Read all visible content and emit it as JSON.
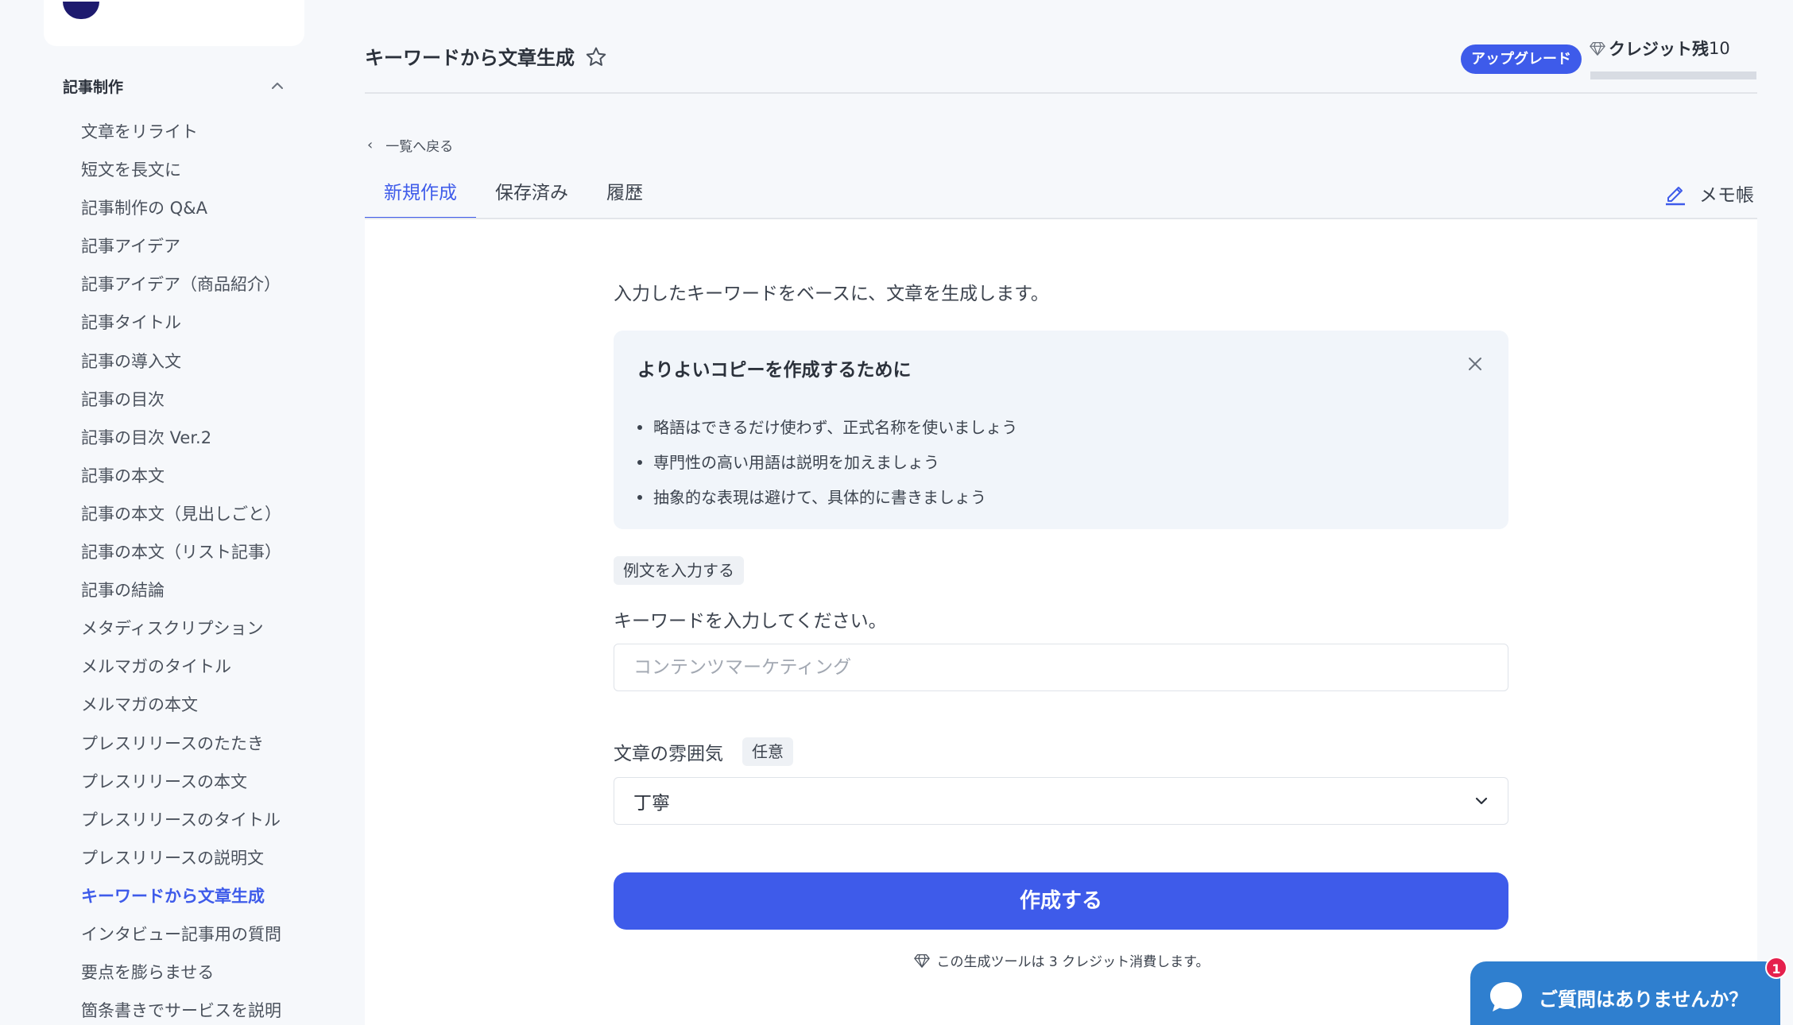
{
  "sidebar": {
    "section_title": "記事制作",
    "items": [
      {
        "label": "文章をリライト"
      },
      {
        "label": "短文を長文に"
      },
      {
        "label": "記事制作の Q&A"
      },
      {
        "label": "記事アイデア"
      },
      {
        "label": "記事アイデア（商品紹介）"
      },
      {
        "label": "記事タイトル"
      },
      {
        "label": "記事の導入文"
      },
      {
        "label": "記事の目次"
      },
      {
        "label": "記事の目次 Ver.2"
      },
      {
        "label": "記事の本文"
      },
      {
        "label": "記事の本文（見出しごと）"
      },
      {
        "label": "記事の本文（リスト記事）"
      },
      {
        "label": "記事の結論"
      },
      {
        "label": "メタディスクリプション"
      },
      {
        "label": "メルマガのタイトル"
      },
      {
        "label": "メルマガの本文"
      },
      {
        "label": "プレスリリースのたたき"
      },
      {
        "label": "プレスリリースの本文"
      },
      {
        "label": "プレスリリースのタイトル"
      },
      {
        "label": "プレスリリースの説明文"
      },
      {
        "label": "キーワードから文章生成",
        "active": true
      },
      {
        "label": "インタビュー記事用の質問"
      },
      {
        "label": "要点を膨らませる"
      },
      {
        "label": "箇条書きでサービスを説明"
      }
    ]
  },
  "header": {
    "title": "キーワードから文章生成",
    "upgrade_label": "アップグレード",
    "credit_label": "クレジット残",
    "credit_value": "10"
  },
  "nav": {
    "back_label": "一覧へ戻る",
    "tabs": [
      {
        "label": "新規作成",
        "active": true
      },
      {
        "label": "保存済み"
      },
      {
        "label": "履歴"
      }
    ],
    "memo_label": "メモ帳"
  },
  "main": {
    "intro": "入力したキーワードをベースに、文章を生成します。",
    "tip": {
      "title": "よりよいコピーを作成するために",
      "items": [
        "略語はできるだけ使わず、正式名称を使いましょう",
        "専門性の高い用語は説明を加えましょう",
        "抽象的な表現は避けて、具体的に書きましょう"
      ]
    },
    "example_label": "例文を入力する",
    "keyword_label": "キーワードを入力してください。",
    "keyword_placeholder": "コンテンツマーケティング",
    "keyword_value": "",
    "mood_label": "文章の雰囲気",
    "optional_label": "任意",
    "mood_selected": "丁寧",
    "submit_label": "作成する",
    "credit_note": "この生成ツールは 3 クレジット消費します。"
  },
  "chat": {
    "label": "ご質問はありませんか？",
    "badge": "1"
  },
  "colors": {
    "accent": "#3e5bea",
    "chat": "#2f7fcf",
    "badge": "#e5204d"
  }
}
